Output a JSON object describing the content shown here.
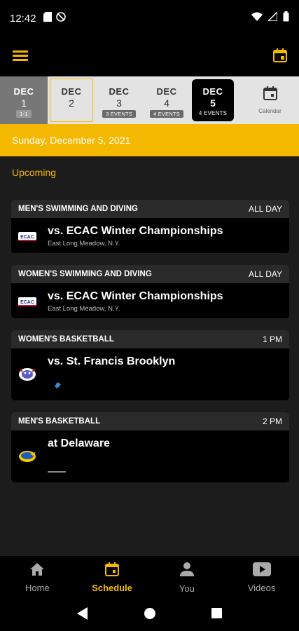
{
  "status": {
    "time": "12:42"
  },
  "colors": {
    "accent": "#f5b800",
    "background": "#1c1c1c",
    "card": "#000000"
  },
  "date_strip": {
    "days": [
      {
        "month": "DEC",
        "day": "1",
        "events": "1-1",
        "state": "past"
      },
      {
        "month": "DEC",
        "day": "2",
        "events": "",
        "state": "today"
      },
      {
        "month": "DEC",
        "day": "3",
        "events": "3 EVENTS",
        "state": "normal"
      },
      {
        "month": "DEC",
        "day": "4",
        "events": "4 EVENTS",
        "state": "normal"
      },
      {
        "month": "DEC",
        "day": "5",
        "events": "4 EVENTS",
        "state": "selected"
      }
    ],
    "calendar_label": "Calendar"
  },
  "selected_date": "Sunday, December 5, 2021",
  "section_title": "Upcoming",
  "events": [
    {
      "sport": "MEN'S SWIMMING AND DIVING",
      "time": "ALL DAY",
      "opponent": "vs. ECAC Winter Championships",
      "location": "East Long Meadow, N.Y.",
      "logo": "ecac-logo"
    },
    {
      "sport": "WOMEN'S SWIMMING AND DIVING",
      "time": "ALL DAY",
      "opponent": "vs. ECAC Winter Championships",
      "location": "East Long Meadow, N.Y.",
      "logo": "ecac-logo"
    },
    {
      "sport": "WOMEN'S BASKETBALL",
      "time": "1 PM",
      "opponent": "vs. St. Francis Brooklyn",
      "location": "",
      "logo": "terriers-logo"
    },
    {
      "sport": "MEN'S BASKETBALL",
      "time": "2 PM",
      "opponent": "at Delaware",
      "location": "",
      "logo": "blue-hens-logo"
    }
  ],
  "bottom_nav": [
    {
      "label": "Home",
      "icon": "home-icon"
    },
    {
      "label": "Schedule",
      "icon": "schedule-icon",
      "active": true
    },
    {
      "label": "You",
      "icon": "person-icon"
    },
    {
      "label": "Videos",
      "icon": "video-icon"
    }
  ]
}
